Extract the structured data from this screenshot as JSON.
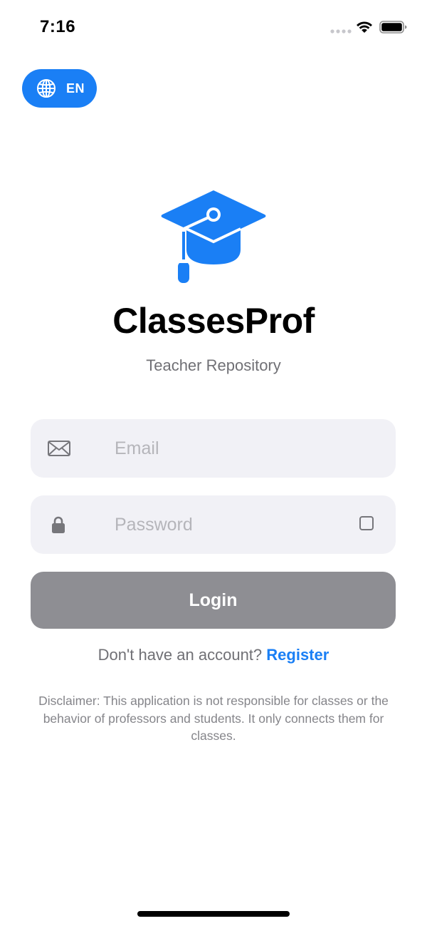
{
  "status_bar": {
    "time": "7:16"
  },
  "language": {
    "code": "EN",
    "icon": "globe-icon"
  },
  "app": {
    "title": "ClassesProf",
    "subtitle": "Teacher Repository",
    "logo_icon": "graduation-cap-icon"
  },
  "login_form": {
    "email_placeholder": "Email",
    "email_value": "",
    "email_icon": "envelope-icon",
    "password_placeholder": "Password",
    "password_value": "",
    "password_icon": "lock-icon",
    "login_label": "Login"
  },
  "register": {
    "prompt": "Don't have an account?",
    "link_label": "Register"
  },
  "disclaimer": "Disclaimer: This application is not responsible for classes or the behavior of professors and students. It only connects them for classes.",
  "colors": {
    "accent": "#1a7ff5",
    "button_disabled": "#8e8e93",
    "field_background": "#f1f1f6"
  }
}
